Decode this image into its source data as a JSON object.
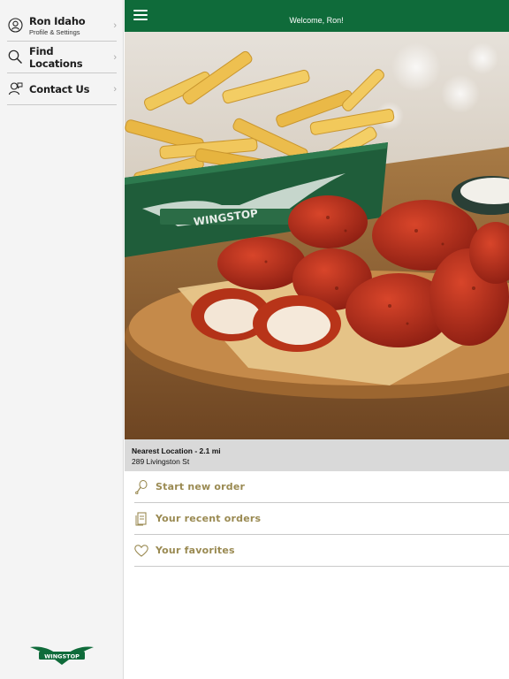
{
  "sidebar": {
    "items": [
      {
        "label": "Ron Idaho",
        "sub": "Profile & Settings",
        "icon": "user-circle-icon"
      },
      {
        "label": "Find Locations",
        "icon": "search-icon"
      },
      {
        "label": "Contact Us",
        "icon": "person-speech-icon"
      }
    ],
    "logo_text": "WINGSTOP"
  },
  "topbar": {
    "welcome": "Welcome, Ron!",
    "menu_icon": "hamburger-icon",
    "color": "#0f6b3a"
  },
  "hero": {
    "basket_text": "WINGSTOP"
  },
  "location": {
    "title": "Nearest Location - 2.1 mi",
    "address": "289 Livingston St"
  },
  "actions": [
    {
      "label": "Start new order",
      "icon": "drumstick-icon"
    },
    {
      "label": "Your recent orders",
      "icon": "receipt-icon"
    },
    {
      "label": "Your favorites",
      "icon": "heart-icon"
    }
  ],
  "colors": {
    "accent_text": "#9a8a52",
    "brand_green": "#0f6b3a"
  }
}
